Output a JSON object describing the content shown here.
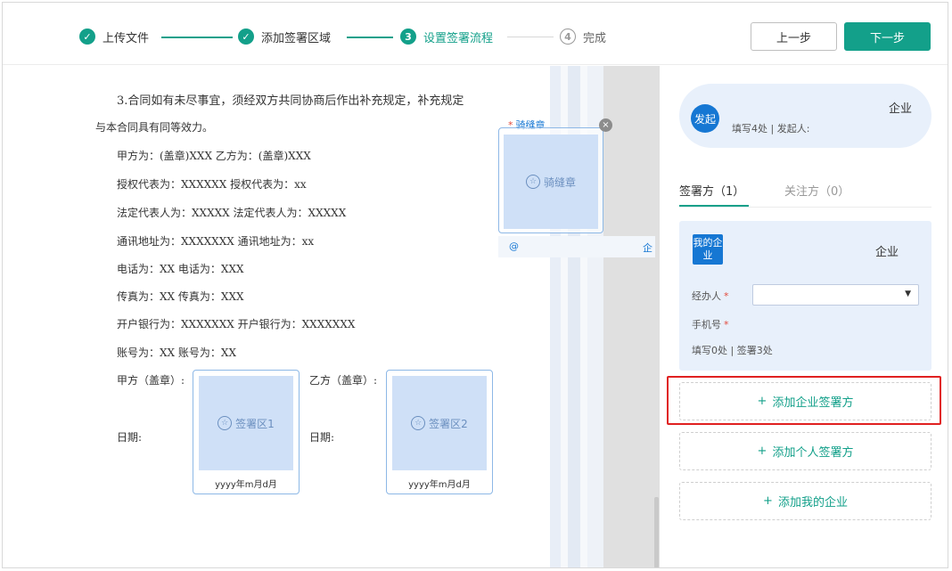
{
  "steps": [
    {
      "number": "✓",
      "label": "上传文件",
      "state": "done"
    },
    {
      "number": "✓",
      "label": "添加签署区域",
      "state": "done"
    },
    {
      "number": "3",
      "label": "设置签署流程",
      "state": "active"
    },
    {
      "number": "4",
      "label": "完成",
      "state": "todo"
    }
  ],
  "buttons": {
    "prev": "上一步",
    "next": "下一步"
  },
  "document": {
    "lines": [
      "3.合同如有未尽事宜，须经双方共同协商后作出补充规定，补充规定",
      "与本合同具有同等效力。",
      "甲方为：(盖章)XXX 乙方为：(盖章)XXX",
      "授权代表为：XXXXXX 授权代表为：xx",
      "法定代表人为：XXXXX 法定代表人为：XXXXX",
      "通讯地址为：XXXXXXX 通讯地址为：xx",
      "电话为：XX 电话为：XXX",
      "传真为：XX 传真为：XXX",
      "开户银行为：XXXXXXX 开户银行为：XXXXXXX",
      "账号为：XX 账号为：XX"
    ],
    "party_a_label": "甲方（盖章）:",
    "party_b_label": "乙方（盖章）:",
    "date_label_a": "日期:",
    "date_label_b": "日期:",
    "sign_area_1": "签署区1",
    "sign_area_2": "签署区2",
    "date_format_1": "yyyy年m月d月",
    "date_format_2": "yyyy年m月d月"
  },
  "seam_seal": {
    "required_mark": "*",
    "title": "骑缝章",
    "inner_label": "骑缝章",
    "close": "×",
    "at": "@",
    "qi": "企"
  },
  "panel": {
    "initiator": {
      "badge": "发起",
      "company": "企业",
      "info": "填写4处 | 发起人:"
    },
    "tabs": {
      "signer": "签署方（1）",
      "follower": "关注方（0）"
    },
    "signer_card": {
      "badge": "我的企业",
      "company": "企业",
      "handler_label": "经办人",
      "phone_label": "手机号",
      "required_mark": "*",
      "handler_value": "",
      "stats": "填写0处 | 签署3处"
    },
    "add_enterprise": "添加企业签署方",
    "add_personal": "添加个人签署方",
    "add_my_enterprise": "添加我的企业"
  },
  "colors": {
    "accent": "#13a08a",
    "blue": "#1677d3",
    "highlight": "#e02020"
  }
}
